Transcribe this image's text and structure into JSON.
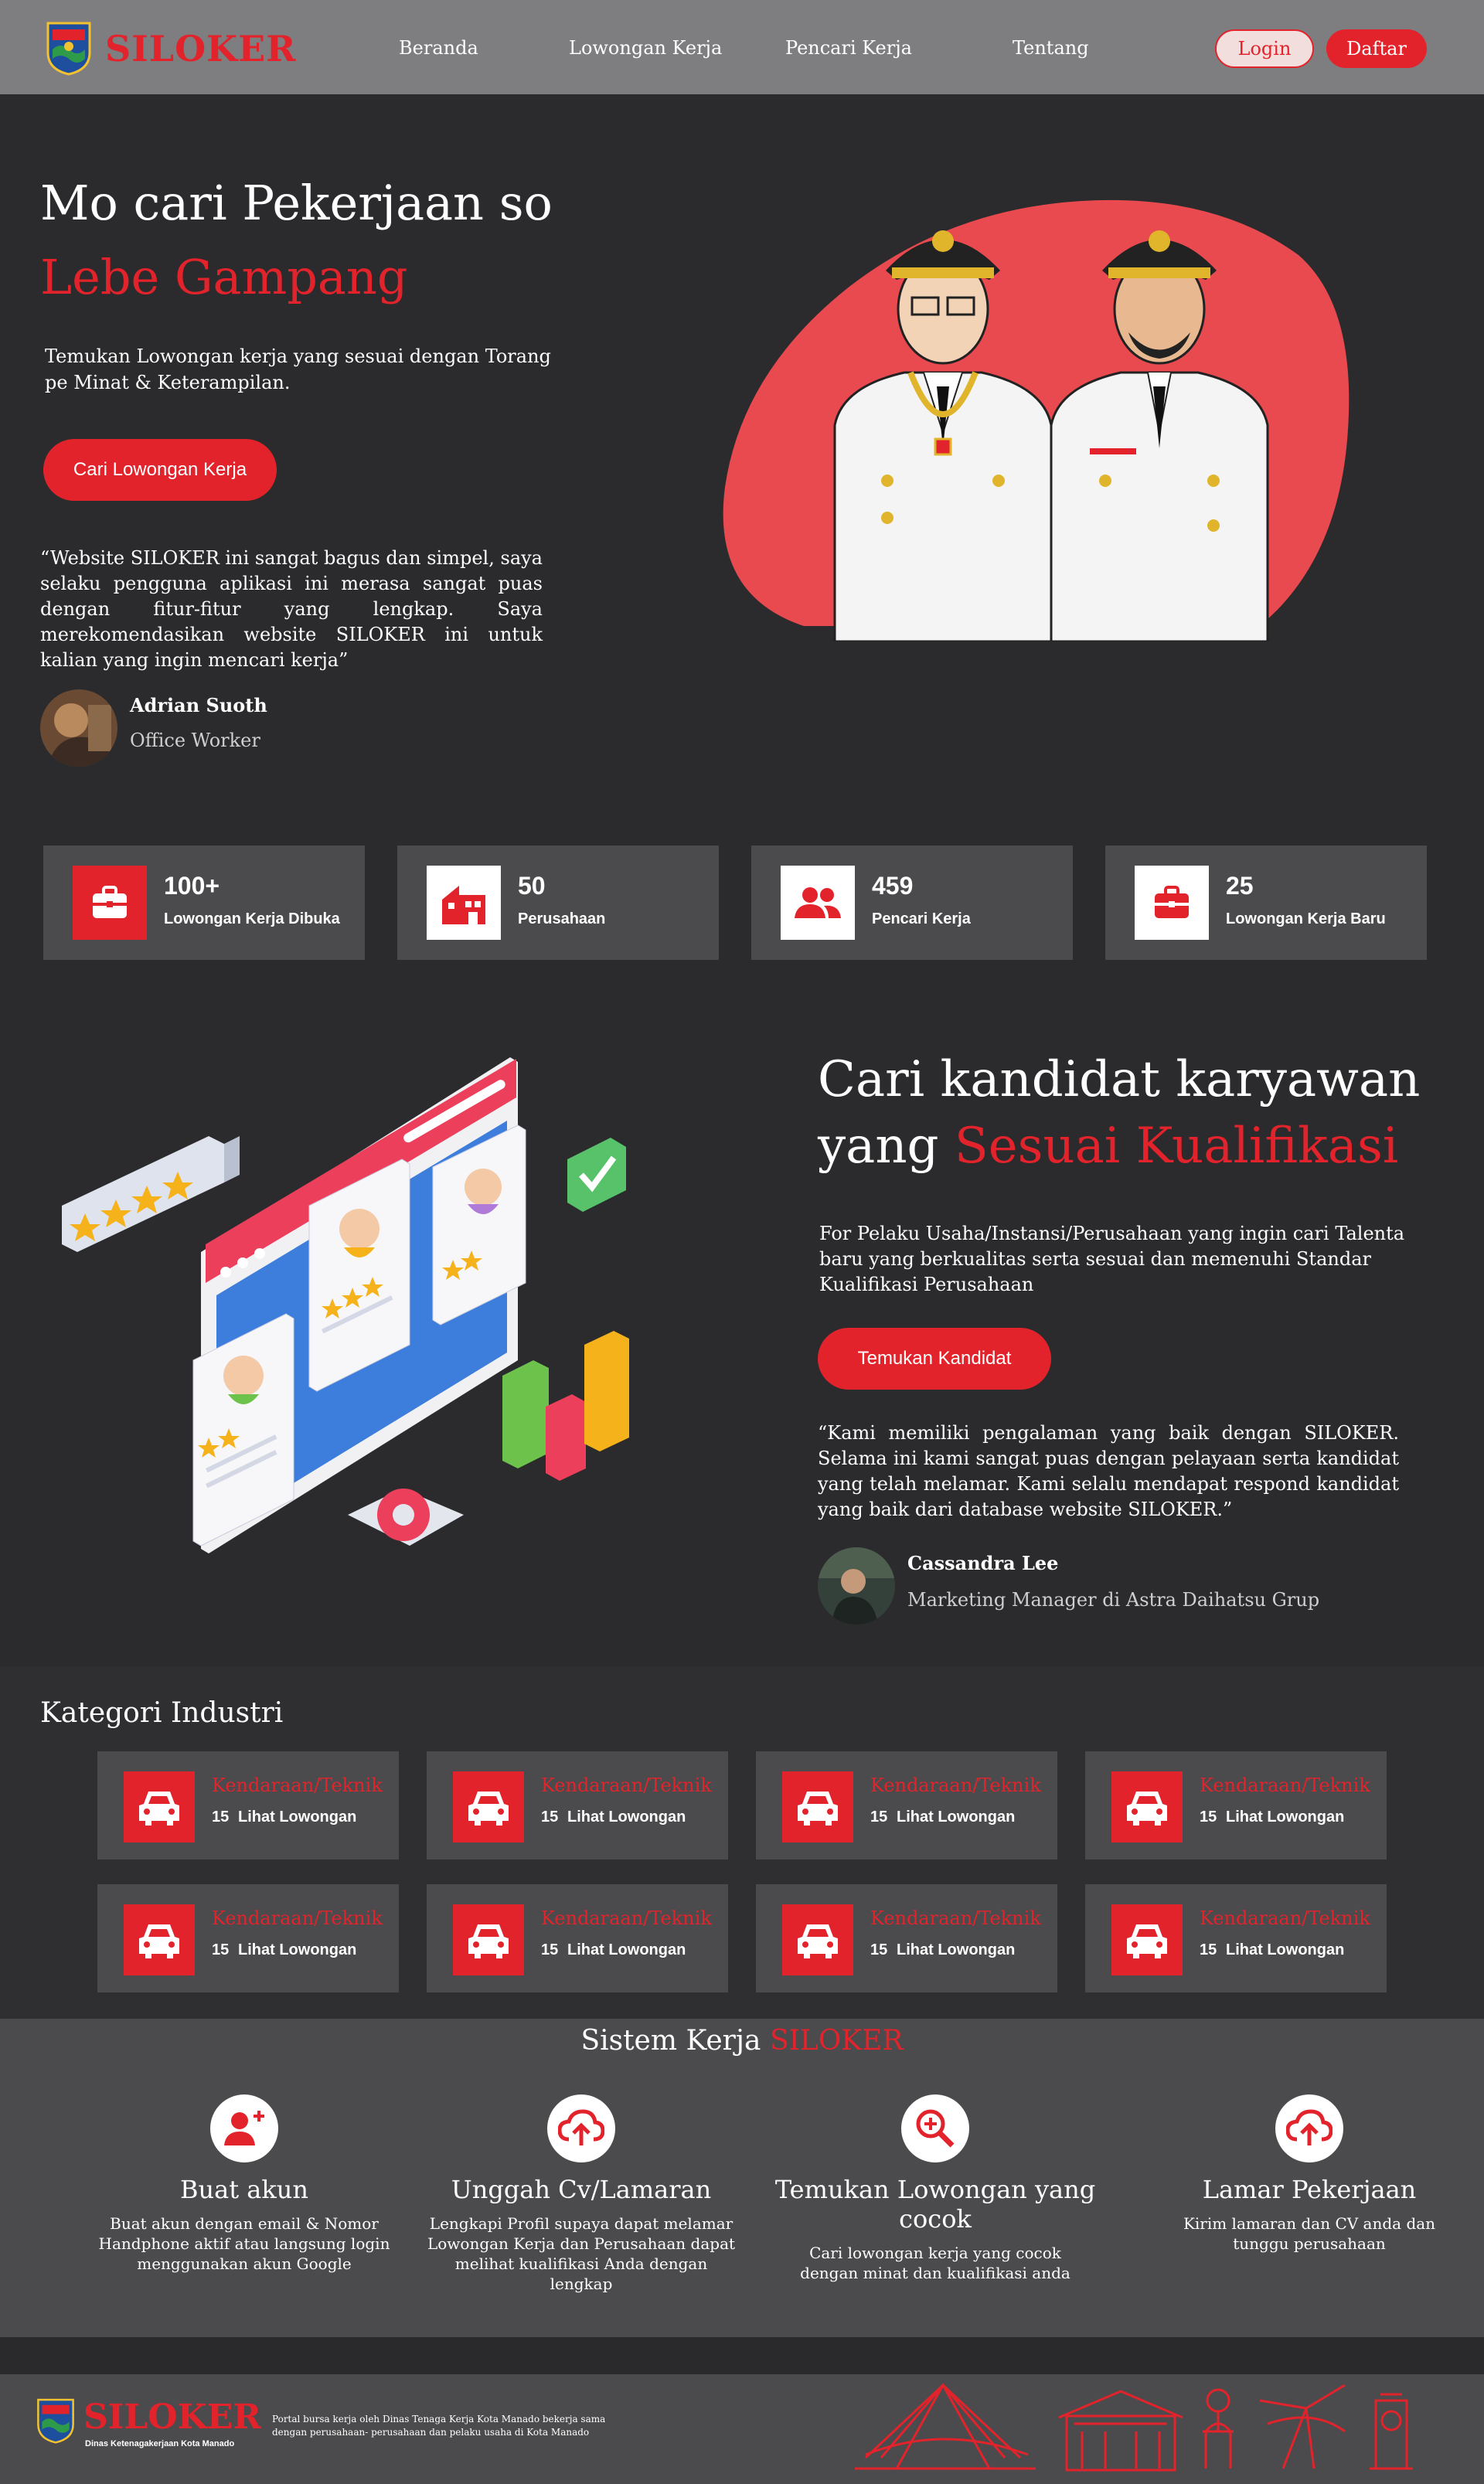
{
  "nav": {
    "brand": "SILOKER",
    "links": [
      "Beranda",
      "Lowongan Kerja",
      "Pencari Kerja",
      "Tentang"
    ],
    "login": "Login",
    "daftar": "Daftar"
  },
  "hero": {
    "title_line1": "Mo cari Pekerjaan so",
    "title_line2": "Lebe Gampang",
    "desc": "Temukan Lowongan kerja yang sesuai dengan Torang pe Minat & Keterampilan.",
    "cta": "Cari Lowongan Kerja",
    "quote": "“Website SILOKER ini sangat bagus dan simpel, saya selaku pengguna aplikasi ini merasa sangat puas dengan fitur-fitur yang lengkap. Saya merekomendasikan website SILOKER ini untuk kalian yang ingin mencari kerja”",
    "person_name": "Adrian Suoth",
    "person_role": "Office Worker"
  },
  "stats": [
    {
      "value": "100+",
      "label": "Lowongan Kerja Dibuka",
      "icon": "briefcase-icon"
    },
    {
      "value": "50",
      "label": "Perusahaan",
      "icon": "building-icon"
    },
    {
      "value": "459",
      "label": "Pencari Kerja",
      "icon": "people-icon"
    },
    {
      "value": "25",
      "label": "Lowongan Kerja Baru",
      "icon": "briefcase-icon"
    }
  ],
  "employer": {
    "title_line1": "Cari kandidat karyawan",
    "title_line2_plain": "yang ",
    "title_line2_red": "Sesuai Kualifikasi",
    "desc": "For Pelaku Usaha/Instansi/Perusahaan yang ingin cari Talenta baru yang berkualitas serta sesuai dan memenuhi Standar Kualifikasi Perusahaan",
    "cta": "Temukan Kandidat",
    "quote": "“Kami memiliki pengalaman yang baik dengan SILOKER. Selama ini kami sangat puas dengan pelayaan serta kandidat yang telah melamar. Kami selalu mendapat respond kandidat yang baik dari database website SILOKER.”",
    "person_name": "Cassandra Lee",
    "person_role": "Marketing Manager di Astra Daihatsu Grup"
  },
  "kategori": {
    "title": "Kategori Industri",
    "items": [
      {
        "name": "Kendaraan/Teknik",
        "count": "15",
        "link": "Lihat Lowongan"
      },
      {
        "name": "Kendaraan/Teknik",
        "count": "15",
        "link": "Lihat Lowongan"
      },
      {
        "name": "Kendaraan/Teknik",
        "count": "15",
        "link": "Lihat Lowongan"
      },
      {
        "name": "Kendaraan/Teknik",
        "count": "15",
        "link": "Lihat Lowongan"
      },
      {
        "name": "Kendaraan/Teknik",
        "count": "15",
        "link": "Lihat Lowongan"
      },
      {
        "name": "Kendaraan/Teknik",
        "count": "15",
        "link": "Lihat Lowongan"
      },
      {
        "name": "Kendaraan/Teknik",
        "count": "15",
        "link": "Lihat Lowongan"
      },
      {
        "name": "Kendaraan/Teknik",
        "count": "15",
        "link": "Lihat Lowongan"
      }
    ]
  },
  "sistem": {
    "title_plain": "Sistem Kerja ",
    "title_red": "SILOKER",
    "steps": [
      {
        "title": "Buat akun",
        "desc": "Buat akun dengan email & Nomor Handphone aktif atau langsung login menggunakan akun Google",
        "icon": "add-user-icon"
      },
      {
        "title": "Unggah Cv/Lamaran",
        "desc": "Lengkapi Profil supaya dapat melamar Lowongan Kerja dan Perusahaan dapat melihat kualifikasi Anda dengan lengkap",
        "icon": "cloud-upload-icon"
      },
      {
        "title": "Temukan Lowongan yang cocok",
        "desc": "Cari lowongan kerja yang cocok dengan minat dan kualifikasi anda",
        "icon": "search-plus-icon"
      },
      {
        "title": "Lamar Pekerjaan",
        "desc": "Kirim lamaran dan CV anda dan tunggu perusahaan",
        "icon": "cloud-upload-icon"
      }
    ]
  },
  "footer": {
    "brand": "SILOKER",
    "subtitle": "Dinas Ketenagakerjaan Kota Manado",
    "desc": "Portal bursa kerja oleh Dinas Tenaga Kerja Kota Manado bekerja sama dengan perusahaan- perusahaan dan pelaku usaha di Kota Manado"
  },
  "colors": {
    "accent": "#e3232b",
    "nav_bg": "#7e7e80",
    "page_bg": "#2b2b2d",
    "card_bg": "#4b4b4d"
  }
}
